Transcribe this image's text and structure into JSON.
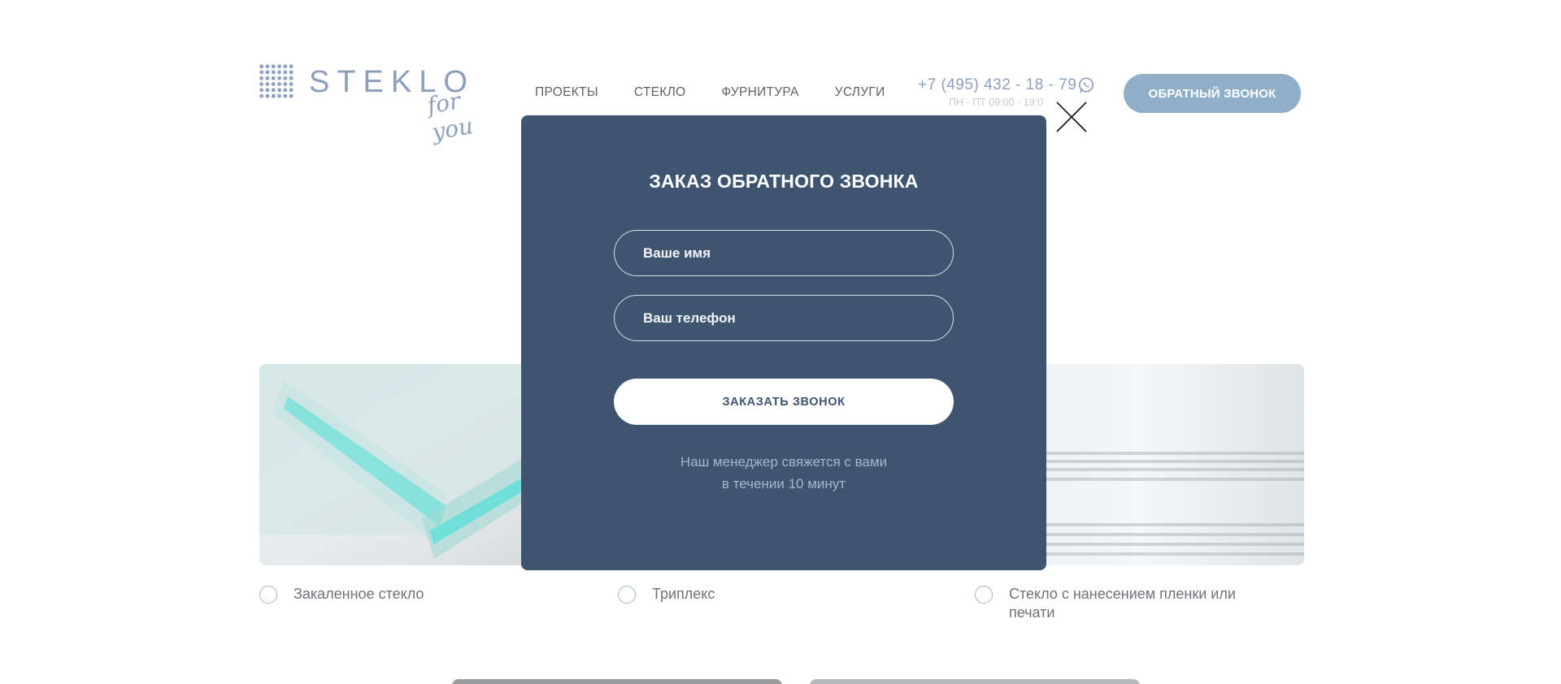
{
  "header": {
    "logo_text": "STEKLO",
    "logo_sub": "for you",
    "nav": [
      "ПРОЕКТЫ",
      "СТЕКЛО",
      "ФУРНИТУРА",
      "УСЛУГИ"
    ],
    "phone": "+7 (495) 432 - 18 - 79",
    "hours": "ПН - ПТ 09:00 - 19:0",
    "callback_button": "ОБРАТНЫЙ ЗВОНОК"
  },
  "products": [
    {
      "label": "Закаленное стекло"
    },
    {
      "label": "Триплекс"
    },
    {
      "label_line1": "Стекло с нанесением пленки или",
      "label_line2": "печати"
    }
  ],
  "modal": {
    "title": "ЗАКАЗ ОБРАТНОГО ЗВОНКА",
    "name_placeholder": "Ваше имя",
    "phone_placeholder": "Ваш телефон",
    "submit_label": "ЗАКАЗАТЬ ЗВОНОК",
    "note_line1": "Наш менеджер свяжется с вами",
    "note_line2": "в течении 10 минут"
  },
  "colors": {
    "modal_bg": "#3f556f",
    "accent": "#8fafc9",
    "logo": "#8c9fbc"
  }
}
